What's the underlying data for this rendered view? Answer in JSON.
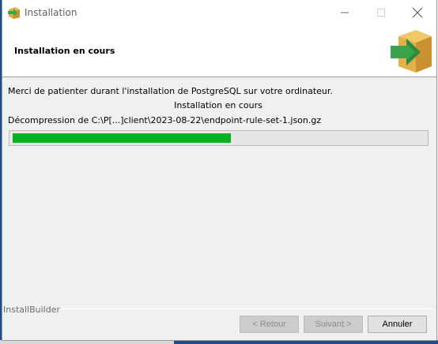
{
  "window": {
    "title": "Installation",
    "icon": "installer-box-arrow-icon"
  },
  "header": {
    "title": "Installation en cours",
    "icon": "installer-box-arrow-icon"
  },
  "content": {
    "intro": "Merci de patienter durant l'installation de PostgreSQL sur votre ordinateur.",
    "status": "Installation en cours",
    "file_line": "Décompression de C:\\P[...]client\\2023-08-22\\endpoint-rule-set-1.json.gz",
    "progress_percent": 53
  },
  "footer": {
    "brand": "InstallBuilder",
    "back_label": "< Retour",
    "next_label": "Suivant >",
    "cancel_label": "Annuler"
  },
  "colors": {
    "progress_fill": "#06b025",
    "progress_track": "#e6e6e6",
    "arrow_green": "#3aa44d",
    "box_tan": "#e5b04a"
  }
}
